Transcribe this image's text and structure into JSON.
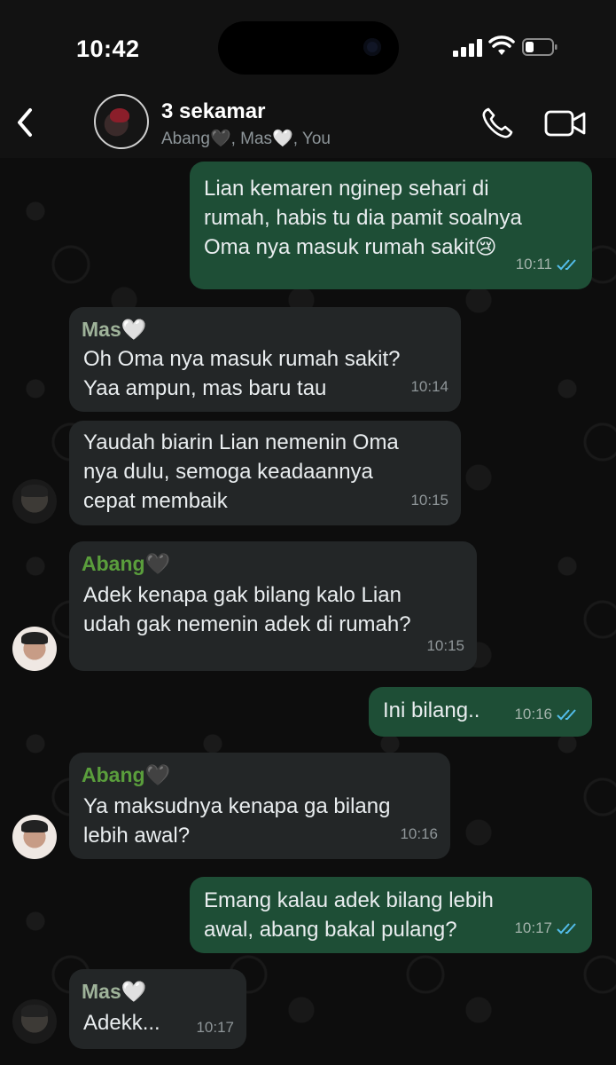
{
  "status_bar": {
    "time": "10:42"
  },
  "header": {
    "back_icon": "chevron-left-icon",
    "title": "3 sekamar",
    "subtitle": "Abang🖤, Mas🤍, You",
    "call_icon": "phone-icon",
    "video_icon": "video-camera-icon"
  },
  "messages": [
    {
      "direction": "out",
      "text": "Lian kemaren nginep sehari di\nrumah, habis tu dia pamit soalnya\nOma nya masuk rumah sakit😢",
      "time": "10:11",
      "read": true
    },
    {
      "direction": "in",
      "sender": "Mas🤍",
      "text": "Oh Oma nya masuk rumah sakit?\nYaa ampun, mas baru tau",
      "time": "10:14"
    },
    {
      "direction": "in",
      "text": "Yaudah biarin Lian nemenin Oma\nnya dulu, semoga keadaannya\ncepat membaik",
      "time": "10:15"
    },
    {
      "direction": "in",
      "sender": "Abang🖤",
      "text": "Adek kenapa gak bilang kalo Lian\nudah gak nemenin adek di rumah?",
      "time": "10:15"
    },
    {
      "direction": "out",
      "text": "Ini bilang..",
      "time": "10:16",
      "read": true
    },
    {
      "direction": "in",
      "sender": "Abang🖤",
      "text": "Ya maksudnya kenapa ga bilang\nlebih awal?",
      "time": "10:16"
    },
    {
      "direction": "out",
      "text": "Emang kalau adek bilang lebih\nawal, abang bakal pulang?",
      "time": "10:17",
      "read": true
    },
    {
      "direction": "in",
      "sender": "Mas🤍",
      "text": "Adekk...",
      "time": "10:17"
    }
  ],
  "colors": {
    "outgoing_bubble": "#1e4e36",
    "incoming_bubble": "#232627",
    "read_tick": "#53bdeb",
    "abang_name": "#5a9e3c",
    "mas_name": "#9fb39a"
  }
}
